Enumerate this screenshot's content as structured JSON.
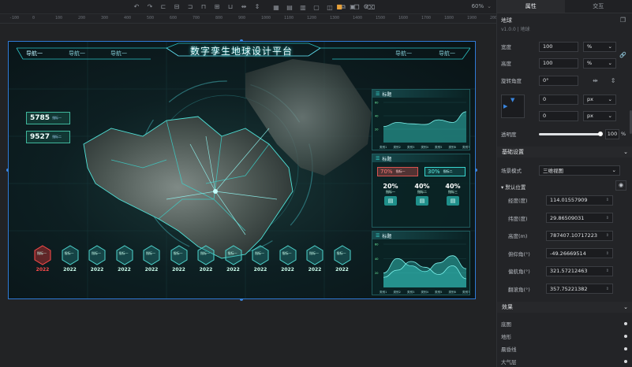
{
  "toolbar": {
    "zoom": "60%"
  },
  "ruler": {
    "marks": [
      "-100",
      "0",
      "100",
      "200",
      "300",
      "400",
      "500",
      "600",
      "700",
      "800",
      "900",
      "1000",
      "1100",
      "1200",
      "1300",
      "1400",
      "1500",
      "1600",
      "1700",
      "1800",
      "1900",
      "2000"
    ]
  },
  "screen": {
    "title": "数字孪生地球设计平台",
    "nav": [
      "导航一",
      "导航一",
      "导航一",
      "导航一",
      "导航一"
    ],
    "metrics": [
      {
        "value": "5785",
        "label": "指标一"
      },
      {
        "value": "9527",
        "label": "指标二"
      }
    ],
    "indicators": {
      "label": "指标一",
      "years": [
        "2022",
        "2022",
        "2022",
        "2022",
        "2022",
        "2022",
        "2022",
        "2022",
        "2022",
        "2022",
        "2022",
        "2022"
      ]
    },
    "panels": {
      "p1": {
        "title": "标题",
        "categories": [
          "类别1",
          "类别2",
          "类别3",
          "类别4",
          "类别5",
          "类别6",
          "类别7"
        ],
        "chart_data": {
          "type": "area",
          "categories": [
            "类别1",
            "类别2",
            "类别3",
            "类别4",
            "类别5",
            "类别6",
            "类别7"
          ],
          "values": [
            24,
            30,
            28,
            27,
            34,
            30,
            46
          ],
          "yticks": [
            "60",
            "40",
            "20"
          ],
          "ylim": [
            0,
            60
          ],
          "color": "#38d6cf"
        }
      },
      "p2": {
        "title": "标题",
        "boxes": [
          {
            "pct": "70%",
            "label": "指标一",
            "color": "#d9534f"
          },
          {
            "pct": "30%",
            "label": "指标二",
            "color": "#38d6cf"
          }
        ],
        "items": [
          {
            "pct": "20%",
            "label": "指标一"
          },
          {
            "pct": "40%",
            "label": "指标二"
          },
          {
            "pct": "40%",
            "label": "指标三"
          }
        ]
      },
      "p3": {
        "title": "标题",
        "categories": [
          "类别1",
          "类别2",
          "类别3",
          "类别4",
          "类别5",
          "类别6",
          "类别7"
        ],
        "chart_data": {
          "type": "area",
          "categories": [
            "类别1",
            "类别2",
            "类别3",
            "类别4",
            "类别5",
            "类别6",
            "类别7"
          ],
          "series": [
            {
              "values": [
                20,
                40,
                30,
                22,
                34,
                44,
                26
              ]
            },
            {
              "values": [
                14,
                24,
                36,
                28,
                18,
                30,
                12
              ]
            }
          ],
          "yticks": [
            "60",
            "40",
            "20"
          ],
          "ylim": [
            0,
            60
          ],
          "color": "#38d6cf"
        }
      }
    }
  },
  "props": {
    "tabs": [
      "属性",
      "交互"
    ],
    "component_name": "地球",
    "version": "v1.0.0 | 地球",
    "width_label": "宽度",
    "width_value": "100",
    "width_unit": "%",
    "height_label": "高度",
    "height_value": "100",
    "height_unit": "%",
    "rotation_label": "旋转角度",
    "rotation_value": "0°",
    "pos_x": "0",
    "pos_x_unit": "px",
    "pos_y": "0",
    "pos_y_unit": "px",
    "opacity_label": "透明度",
    "opacity_value": "100",
    "opacity_unit": "%",
    "opacity": 1.0,
    "basic_section": "基础设置",
    "scene_mode_label": "场景模式",
    "scene_mode_value": "三维视图",
    "default_pos_label": "默认位置",
    "fields": [
      {
        "label": "经度(度)",
        "value": "114.01557909"
      },
      {
        "label": "纬度(度)",
        "value": "29.86509031"
      },
      {
        "label": "高度(m)",
        "value": "787407.10717223"
      },
      {
        "label": "俯仰角(°)",
        "value": "-49.26669514"
      },
      {
        "label": "偏航角(°)",
        "value": "321.57212463"
      },
      {
        "label": "翻滚角(°)",
        "value": "357.75221382"
      }
    ],
    "effect_section": "效果",
    "toggles": [
      "底图",
      "地形",
      "晨昏线",
      "大气层"
    ]
  }
}
